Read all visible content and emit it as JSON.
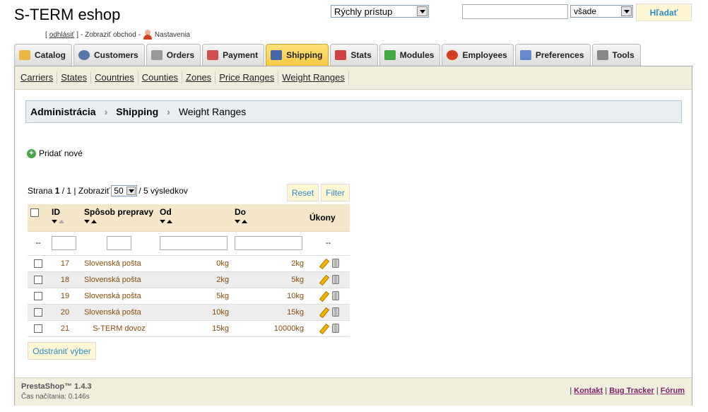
{
  "header": {
    "shop_title": "S-TERM eshop",
    "logout_label": "odhlásiť",
    "view_shop_label": "- Zobraziť obchod -",
    "settings_label": "Nastavenia",
    "quick_access_value": "Rýchly prístup",
    "scope_value": "všade",
    "search_button_label": "Hľadať"
  },
  "tabs": [
    {
      "label": "Catalog",
      "icon": "folder-icon",
      "color": "#e8b840"
    },
    {
      "label": "Customers",
      "icon": "customers-icon",
      "color": "#5577aa"
    },
    {
      "label": "Orders",
      "icon": "cart-icon",
      "color": "#999999"
    },
    {
      "label": "Payment",
      "icon": "payment-icon",
      "color": "#d05050"
    },
    {
      "label": "Shipping",
      "icon": "truck-icon",
      "color": "#4466aa",
      "active": true
    },
    {
      "label": "Stats",
      "icon": "stats-icon",
      "color": "#cc4444"
    },
    {
      "label": "Modules",
      "icon": "puzzle-icon",
      "color": "#44aa44"
    },
    {
      "label": "Employees",
      "icon": "employee-icon",
      "color": "#d04020"
    },
    {
      "label": "Preferences",
      "icon": "preferences-icon",
      "color": "#6688cc"
    },
    {
      "label": "Tools",
      "icon": "wrench-icon",
      "color": "#888888"
    }
  ],
  "subnav": [
    "Carriers",
    "States",
    "Countries",
    "Counties",
    "Zones",
    "Price Ranges",
    "Weight Ranges"
  ],
  "breadcrumb": {
    "root": "Administrácia",
    "section": "Shipping",
    "current": "Weight Ranges"
  },
  "add_new_label": "Pridať nové",
  "pager": {
    "page_word": "Strana",
    "current": "1",
    "total": "/ 1 | Zobraziť",
    "per_page": "50",
    "results": "/ 5 výsledkov"
  },
  "reset_label": "Reset",
  "filter_label": "Filter",
  "table": {
    "headers": {
      "id": "ID",
      "carrier": "Spôsob prepravy",
      "from": "Od",
      "to": "Do",
      "actions": "Úkony"
    },
    "filter_dash": "--",
    "rows": [
      {
        "id": "17",
        "carrier": "Slovenská pošta",
        "from": "0kg",
        "to": "2kg"
      },
      {
        "id": "18",
        "carrier": "Slovenská pošta",
        "from": "2kg",
        "to": "5kg"
      },
      {
        "id": "19",
        "carrier": "Slovenská pošta",
        "from": "5kg",
        "to": "10kg"
      },
      {
        "id": "20",
        "carrier": "Slovenská pošta",
        "from": "10kg",
        "to": "15kg"
      },
      {
        "id": "21",
        "carrier": "S-TERM dovoz",
        "from": "15kg",
        "to": "10000kg"
      }
    ]
  },
  "remove_selection_label": "Odstrániť výber",
  "footer": {
    "version": "PrestaShop™ 1.4.3",
    "load_time": "Čas načítania: 0.146s",
    "link_contact": "Kontakt",
    "link_bugs": "Bug Tracker",
    "link_forum": "Fórum"
  }
}
